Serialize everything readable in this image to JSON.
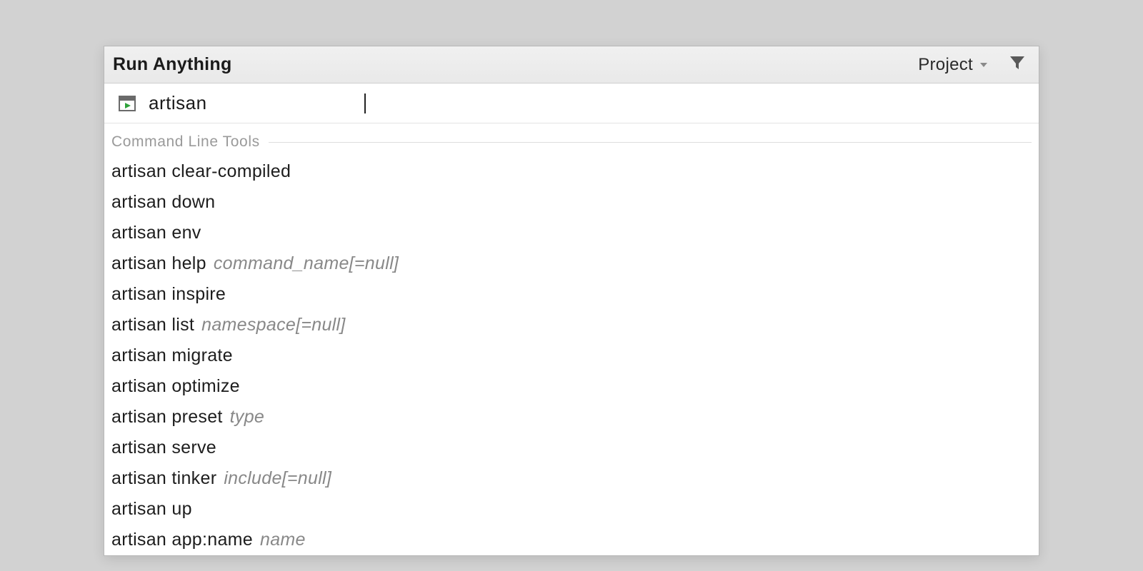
{
  "titlebar": {
    "title": "Run Anything",
    "project_label": "Project"
  },
  "search": {
    "value": "artisan "
  },
  "section": {
    "label": "Command Line Tools"
  },
  "suggestions": [
    {
      "command": "artisan clear-compiled",
      "hint": ""
    },
    {
      "command": "artisan down",
      "hint": ""
    },
    {
      "command": "artisan env",
      "hint": ""
    },
    {
      "command": "artisan help",
      "hint": "command_name[=null]"
    },
    {
      "command": "artisan inspire",
      "hint": ""
    },
    {
      "command": "artisan list",
      "hint": "namespace[=null]"
    },
    {
      "command": "artisan migrate",
      "hint": ""
    },
    {
      "command": "artisan optimize",
      "hint": ""
    },
    {
      "command": "artisan preset",
      "hint": "type"
    },
    {
      "command": "artisan serve",
      "hint": ""
    },
    {
      "command": "artisan tinker",
      "hint": "include[=null]"
    },
    {
      "command": "artisan up",
      "hint": ""
    },
    {
      "command": "artisan app:name",
      "hint": "name"
    }
  ]
}
